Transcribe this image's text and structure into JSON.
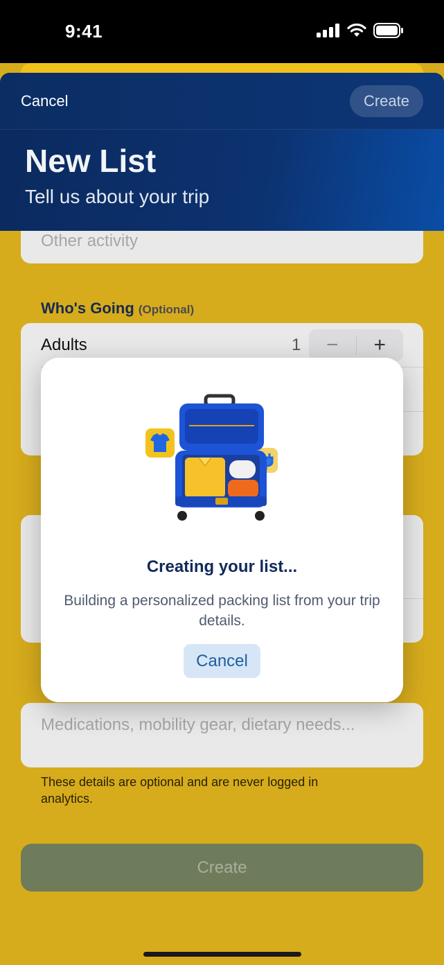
{
  "status_bar": {
    "time": "9:41"
  },
  "nav": {
    "cancel_label": "Cancel",
    "create_label": "Create",
    "title": "New List",
    "subtitle": "Tell us about your trip"
  },
  "form": {
    "other_activity_placeholder": "Other activity",
    "whos_going_label": "Who's Going",
    "whos_going_optional": "(Optional)",
    "adults_label": "Adults",
    "adults_value": "1",
    "minus_symbol": "−",
    "plus_symbol": "+",
    "needs_placeholder": "Medications, mobility gear, dietary needs...",
    "footnote": "These details are optional and are never logged in analytics.",
    "create_label": "Create"
  },
  "modal": {
    "title": "Creating your list...",
    "message": "Building a personalized packing list from your trip details.",
    "cancel_label": "Cancel"
  },
  "colors": {
    "sheet_yellow": "#D7AC1C",
    "nav_blue": "#0B2D63",
    "modal_title": "#0F2A5B",
    "disabled_create": "#6F7C5C"
  }
}
